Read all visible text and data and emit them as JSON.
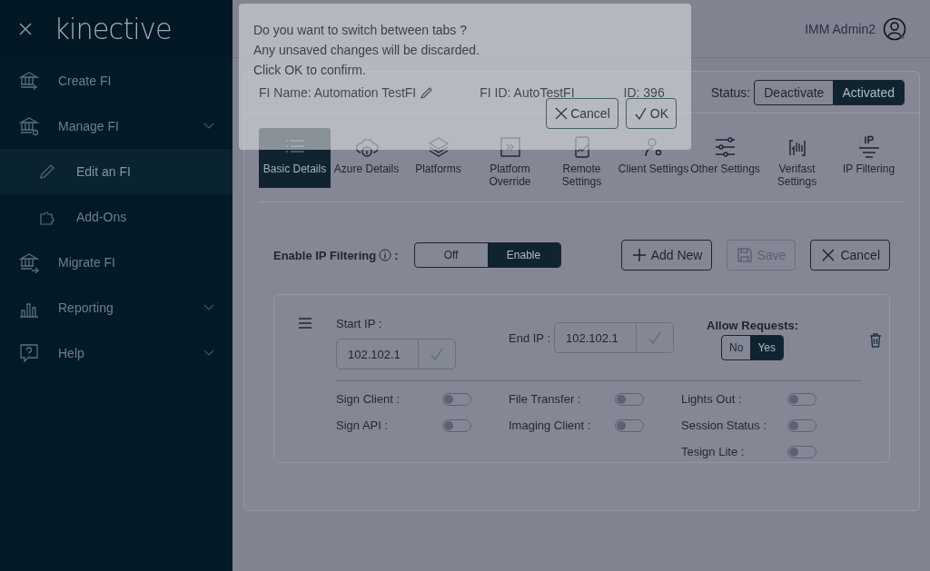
{
  "sidebar": {
    "logo": "kinective",
    "items": [
      {
        "label": "Create FI",
        "selected": false,
        "chevron": false
      },
      {
        "label": "Manage FI",
        "selected": false,
        "chevron": true,
        "children": [
          {
            "label": "Edit an FI",
            "selected": true
          },
          {
            "label": "Add-Ons",
            "selected": false
          }
        ]
      },
      {
        "label": "Migrate FI",
        "selected": false,
        "chevron": false
      },
      {
        "label": "Reporting",
        "selected": false,
        "chevron": true
      },
      {
        "label": "Help",
        "selected": false,
        "chevron": true
      }
    ]
  },
  "header": {
    "user": "IMM Admin2"
  },
  "fi_info": {
    "name": "FI Name: Automation TestFI",
    "fi_id": "FI ID: AutoTestFI",
    "id": "ID: 396",
    "status_label": "Status:",
    "status_options": [
      {
        "label": "Deactivate",
        "selected": false
      },
      {
        "label": "Activated",
        "selected": true
      }
    ]
  },
  "tabs": [
    {
      "label": "Basic Details",
      "selected": true
    },
    {
      "label": "Azure Details",
      "selected": false
    },
    {
      "label": "Platforms",
      "selected": false
    },
    {
      "label": "Platform Override",
      "selected": false
    },
    {
      "label": "Remote Settings",
      "selected": false
    },
    {
      "label": "Client Settings",
      "selected": false
    },
    {
      "label": "Other Settings",
      "selected": false
    },
    {
      "label": "Verifast Settings",
      "selected": false
    },
    {
      "label": "IP Filtering",
      "selected": false
    }
  ],
  "ip_filtering": {
    "label": "Enable IP Filtering",
    "colon": ":",
    "options": [
      {
        "label": "Off",
        "selected": false
      },
      {
        "label": "Enable",
        "selected": true
      }
    ],
    "buttons": [
      {
        "label": "Add New",
        "kind": "add",
        "disabled": false
      },
      {
        "label": "Save",
        "kind": "save",
        "disabled": true
      },
      {
        "label": "Cancel",
        "kind": "cancel",
        "disabled": false
      }
    ]
  },
  "rule": {
    "start_label": "Start IP :",
    "start_value": "102.102.1",
    "end_label": "End IP :",
    "end_value": "102.102.1",
    "allow_label": "Allow Requests:",
    "allow_options": [
      {
        "label": "No",
        "selected": false
      },
      {
        "label": "Yes",
        "selected": true
      }
    ],
    "switch_columns": [
      [
        {
          "label": "Sign Client :",
          "on": false
        },
        {
          "label": "Sign API :",
          "on": false
        }
      ],
      [
        {
          "label": "File Transfer :",
          "on": false
        },
        {
          "label": "Imaging Client :",
          "on": false
        }
      ],
      [
        {
          "label": "Lights Out :",
          "on": false
        },
        {
          "label": "Session Status :",
          "on": false
        },
        {
          "label": "Tesign Lite :",
          "on": false
        }
      ]
    ]
  },
  "dialog": {
    "lines": [
      "Do you want to switch between tabs ?",
      "Any unsaved changes will be discarded.",
      "Click OK to confirm."
    ],
    "buttons": [
      {
        "label": "Cancel",
        "kind": "cancel"
      },
      {
        "label": "OK",
        "kind": "ok"
      }
    ]
  }
}
